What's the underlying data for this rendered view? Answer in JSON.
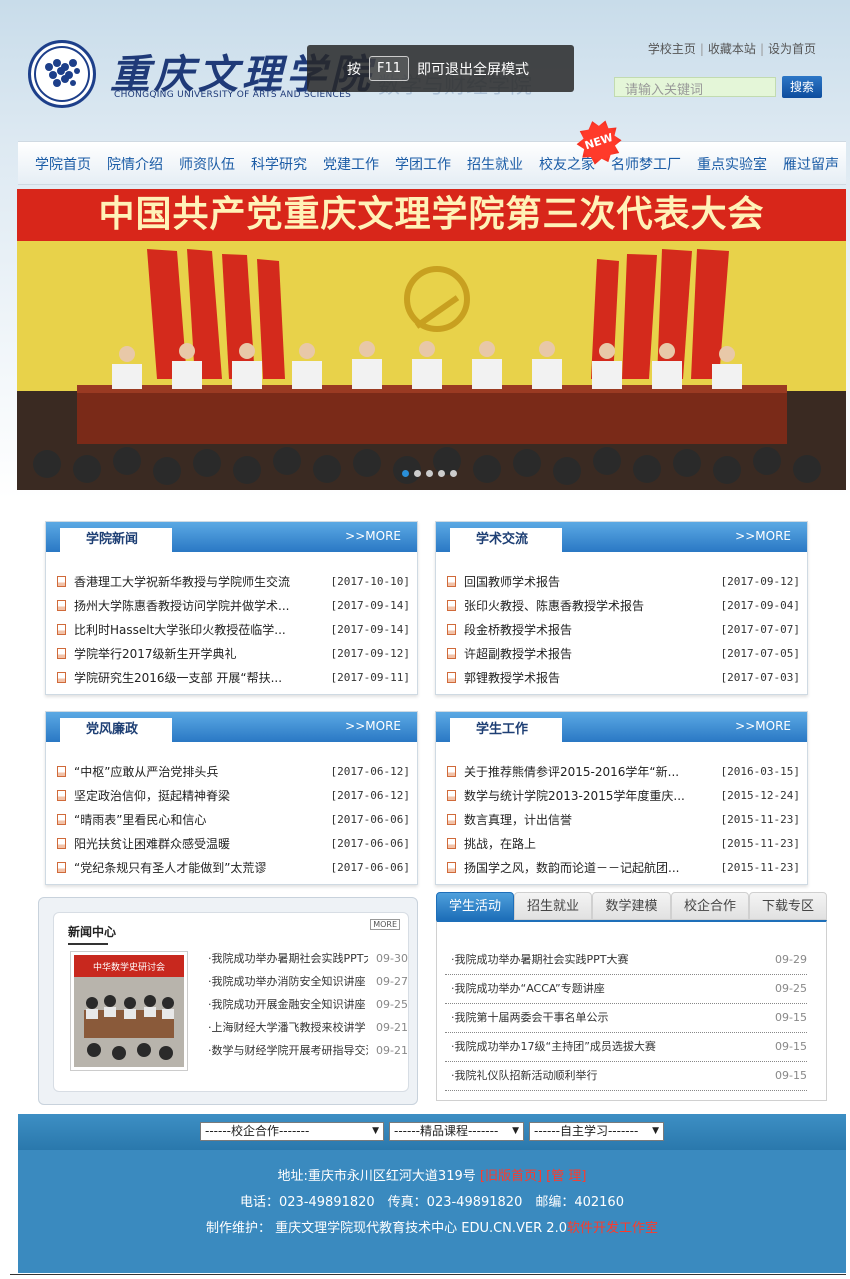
{
  "header": {
    "logo_cn": "重庆文理学院",
    "logo_en": "CHONGQING UNIVERSITY OF ARTS AND SCIENCES",
    "logo_sub": "数学与财经学院",
    "fullscreen_tip": {
      "prefix": "按",
      "key": "F11",
      "suffix": "即可退出全屏模式"
    },
    "top_links": [
      "学校主页",
      "收藏本站",
      "设为首页"
    ],
    "search_placeholder": "请输入关键词",
    "search_button": "搜索"
  },
  "nav": {
    "items": [
      "学院首页",
      "院情介绍",
      "师资队伍",
      "科学研究",
      "党建工作",
      "学团工作",
      "招生就业",
      "校友之家",
      "名师梦工厂",
      "重点实验室",
      "雁过留声"
    ],
    "new_badge": "NEW"
  },
  "banner": {
    "title": "中国共产党重庆文理学院第三次代表大会",
    "slide_count": 5,
    "active_slide": 1
  },
  "boxes": [
    {
      "title": "学院新闻",
      "more": ">>MORE",
      "items": [
        {
          "title": "香港理工大学祝新华教授与学院师生交流",
          "date": "[2017-10-10]"
        },
        {
          "title": "扬州大学陈惠香教授访问学院并做学术...",
          "date": "[2017-09-14]"
        },
        {
          "title": "比利时Hasselt大学张印火教授莅临学...",
          "date": "[2017-09-14]"
        },
        {
          "title": "学院举行2017级新生开学典礼",
          "date": "[2017-09-12]"
        },
        {
          "title": "学院研究生2016级一支部 开展“帮扶...",
          "date": "[2017-09-11]"
        }
      ]
    },
    {
      "title": "学术交流",
      "more": ">>MORE",
      "items": [
        {
          "title": "回国教师学术报告",
          "date": "[2017-09-12]"
        },
        {
          "title": "张印火教授、陈惠香教授学术报告",
          "date": "[2017-09-04]"
        },
        {
          "title": "段金桥教授学术报告",
          "date": "[2017-07-07]"
        },
        {
          "title": "许超副教授学术报告",
          "date": "[2017-07-05]"
        },
        {
          "title": "郭锂教授学术报告",
          "date": "[2017-07-03]"
        }
      ]
    },
    {
      "title": "党风廉政",
      "more": ">>MORE",
      "items": [
        {
          "title": "“中枢”应敢从严治党排头兵",
          "date": "[2017-06-12]"
        },
        {
          "title": "坚定政治信仰，挺起精神脊梁",
          "date": "[2017-06-12]"
        },
        {
          "title": "“晴雨表”里看民心和信心",
          "date": "[2017-06-06]"
        },
        {
          "title": "阳光扶贫让困难群众感受温暖",
          "date": "[2017-06-06]"
        },
        {
          "title": "“党纪条规只有圣人才能做到”太荒谬",
          "date": "[2017-06-06]"
        }
      ]
    },
    {
      "title": "学生工作",
      "more": ">>MORE",
      "items": [
        {
          "title": "关于推荐熊倩参评2015-2016学年“新...",
          "date": "[2016-03-15]"
        },
        {
          "title": "数学与统计学院2013-2015学年度重庆...",
          "date": "[2015-12-24]"
        },
        {
          "title": "数言真理，计出信誉",
          "date": "[2015-11-23]"
        },
        {
          "title": "挑战，在路上",
          "date": "[2015-11-23]"
        },
        {
          "title": "扬国学之风，数韵而论道－－记起航团...",
          "date": "[2015-11-23]"
        }
      ]
    }
  ],
  "news_center": {
    "title": "新闻中心",
    "more": "MORE",
    "photo_caption": "中华数学史研讨会",
    "items": [
      {
        "title": "·我院成功举办暑期社会实践PPT大赛",
        "date": "09-30"
      },
      {
        "title": "·我院成功举办消防安全知识讲座",
        "date": "09-27"
      },
      {
        "title": "·我院成功开展金融安全知识讲座",
        "date": "09-25"
      },
      {
        "title": "·上海财经大学潘飞教授来校讲学",
        "date": "09-21"
      },
      {
        "title": "·数学与财经学院开展考研指导交流咨询会",
        "date": "09-21"
      }
    ]
  },
  "tabpanel": {
    "tabs": [
      "学生活动",
      "招生就业",
      "数学建模",
      "校企合作",
      "下载专区"
    ],
    "active": 0,
    "items": [
      {
        "title": "·我院成功举办暑期社会实践PPT大赛",
        "date": "09-29"
      },
      {
        "title": "·我院成功举办“ACCA”专题讲座",
        "date": "09-25"
      },
      {
        "title": "·我院第十届两委会干事名单公示",
        "date": "09-15"
      },
      {
        "title": "·我院成功举办17级“主持团”成员选拔大赛",
        "date": "09-15"
      },
      {
        "title": "·我院礼仪队招新活动顺利举行",
        "date": "09-15"
      }
    ]
  },
  "footer": {
    "selects": [
      "------校企合作-------",
      "------精品课程-------",
      "------自主学习-------"
    ],
    "address_prefix": "地址:重庆市永川区红河大道319号 ",
    "old_home": "[旧版首页]",
    "admin": "[管 理]",
    "contact": "电话：023-49891820　传真：023-49891820　邮编：402160",
    "maintain_prefix": "制作维护： 重庆文理学院现代教育技术中心 EDU.CN.VER 2.0",
    "maintain_team": "软件开发工作室"
  }
}
